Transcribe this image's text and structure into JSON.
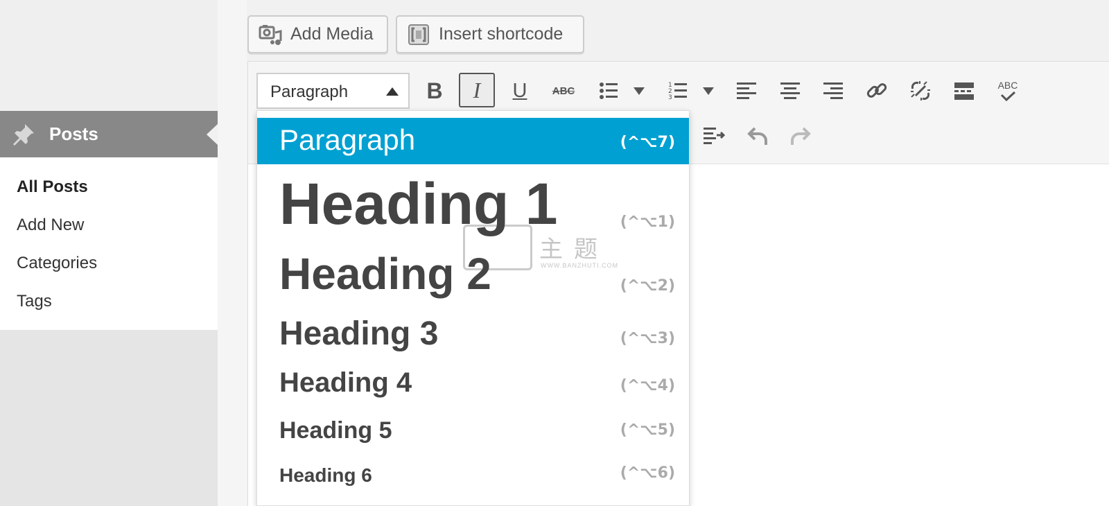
{
  "sidebar": {
    "section_label": "Posts",
    "items": [
      {
        "label": "All Posts",
        "active": true
      },
      {
        "label": "Add New",
        "active": false
      },
      {
        "label": "Categories",
        "active": false
      },
      {
        "label": "Tags",
        "active": false
      }
    ]
  },
  "media_buttons": {
    "add_media": "Add Media",
    "insert_shortcode": "Insert shortcode"
  },
  "toolbar": {
    "format_select_value": "Paragraph",
    "buttons": [
      {
        "name": "bold",
        "icon": "bold-icon",
        "glyph": "B"
      },
      {
        "name": "italic",
        "icon": "italic-icon",
        "glyph": "I",
        "pressed": true
      },
      {
        "name": "underline",
        "icon": "underline-icon",
        "glyph": "U"
      },
      {
        "name": "strikethrough",
        "icon": "strikethrough-icon",
        "glyph": "ABC"
      },
      {
        "name": "bullet-list",
        "icon": "bullet-list-icon"
      },
      {
        "name": "numbered-list",
        "icon": "numbered-list-icon"
      },
      {
        "name": "align-left",
        "icon": "align-left-icon"
      },
      {
        "name": "align-center",
        "icon": "align-center-icon"
      },
      {
        "name": "align-right",
        "icon": "align-right-icon"
      },
      {
        "name": "insert-link",
        "icon": "link-icon"
      },
      {
        "name": "remove-link",
        "icon": "unlink-icon"
      },
      {
        "name": "read-more",
        "icon": "read-more-icon"
      },
      {
        "name": "spellcheck",
        "icon": "spellcheck-icon",
        "glyph": "ABC"
      },
      {
        "name": "indent",
        "icon": "indent-icon"
      },
      {
        "name": "undo",
        "icon": "undo-icon"
      },
      {
        "name": "redo",
        "icon": "redo-icon"
      }
    ]
  },
  "format_dropdown": {
    "items": [
      {
        "label": "Paragraph",
        "shortcut": "(^⌥7)",
        "selected": true
      },
      {
        "label": "Heading 1",
        "shortcut": "(^⌥1)"
      },
      {
        "label": "Heading 2",
        "shortcut": "(^⌥2)"
      },
      {
        "label": "Heading 3",
        "shortcut": "(^⌥3)"
      },
      {
        "label": "Heading 4",
        "shortcut": "(^⌥4)"
      },
      {
        "label": "Heading 5",
        "shortcut": "(^⌥5)"
      },
      {
        "label": "Heading 6",
        "shortcut": "(^⌥6)"
      }
    ]
  },
  "watermark": {
    "chars": "主题",
    "url": "WWW.BANZHUTI.COM"
  },
  "colors": {
    "accent": "#00a0d2",
    "sidebar_active": "#888888"
  }
}
